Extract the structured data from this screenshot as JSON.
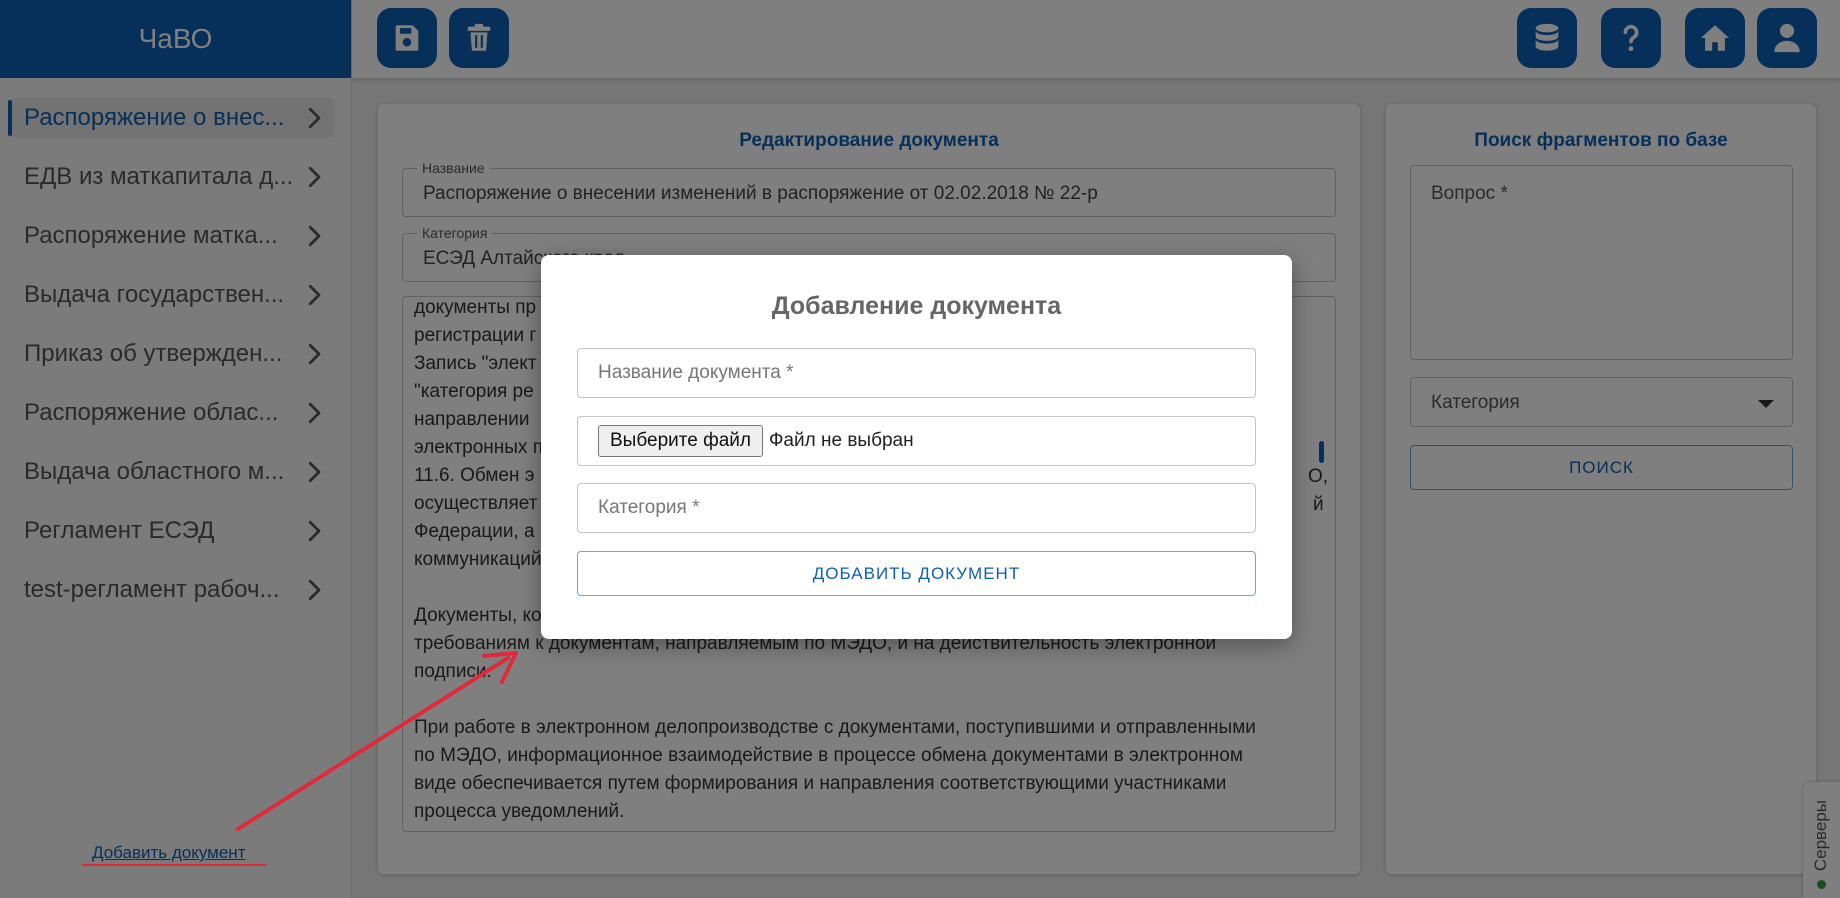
{
  "app": {
    "title": "ЧаВО"
  },
  "sidebar": {
    "items": [
      {
        "label": "Распоряжение о внес..."
      },
      {
        "label": "ЕДВ из маткапитала д..."
      },
      {
        "label": "Распоряжение матка..."
      },
      {
        "label": "Выдача государствен..."
      },
      {
        "label": "Приказ об утвержден..."
      },
      {
        "label": "Распоряжение облас..."
      },
      {
        "label": "Выдача областного м..."
      },
      {
        "label": "Регламент ЕСЭД"
      },
      {
        "label": "test-регламент рабоч..."
      }
    ],
    "add_document_link": "Добавить документ"
  },
  "toolbar": {
    "left_buttons": [
      "save-icon",
      "trash-icon"
    ],
    "right_buttons": [
      "database-icon",
      "help-icon",
      "home-icon",
      "user-icon"
    ]
  },
  "editor": {
    "title": "Редактирование документа",
    "name_label": "Название",
    "name_value": "Распоряжение о внесении изменений в распоряжение от 02.02.2018 № 22-р",
    "category_label": "Категория",
    "category_value": "ЕСЭД Алтайского края",
    "text_lines": [
      "документы пр",
      "регистрации г",
      "Запись \"элект",
      "\"категория ре",
      "направлении ",
      "электронных п",
      "11.6. Обмен э",
      "осуществляет",
      "Федерации, а",
      "коммуникаций",
      "",
      "Документы, ко",
      "требованиям к документам, направляемым по МЭДО, и на действительность электронной",
      "подписи.",
      "",
      "При работе в электронном делопроизводстве с документами, поступившими и отправленными",
      "по МЭДО, информационное взаимодействие в процессе обмена документами в электронном",
      "виде обеспечивается путем формирования и направления соответствующими участниками",
      "процесса уведомлений."
    ],
    "right_fragments": {
      "line7": "О,",
      "line8": "й"
    }
  },
  "search_panel": {
    "title": "Поиск фрагментов по базе",
    "question_label": "Вопрос *",
    "category_label": "Категория",
    "search_button": "ПОИСК"
  },
  "servers_tab": {
    "label": "Серверы",
    "status_color": "#2e9e44"
  },
  "modal": {
    "title": "Добавление документа",
    "name_placeholder": "Название документа *",
    "file_button": "Выберите файл",
    "file_status": "Файл не выбран",
    "category_placeholder": "Категория *",
    "submit_button": "ДОБАВИТЬ ДОКУМЕНТ"
  },
  "colors": {
    "primary": "#0d5fb4",
    "annotation": "#e02a3a"
  }
}
